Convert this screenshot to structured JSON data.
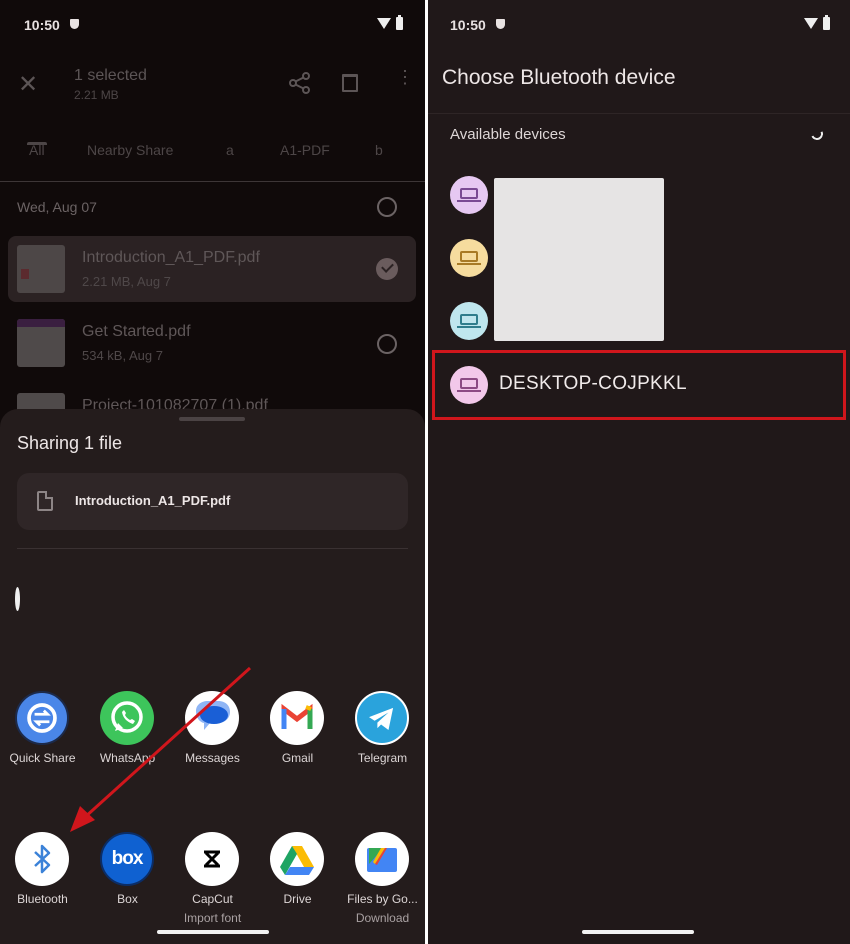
{
  "status_bar": {
    "time": "10:50"
  },
  "left": {
    "appbar": {
      "title": "1 selected",
      "subtitle": "2.21 MB"
    },
    "tabs": [
      "All",
      "Nearby Share",
      "a",
      "A1-PDF",
      "b"
    ],
    "active_tab": "All",
    "date_header": "Wed, Aug 07",
    "files": [
      {
        "name": "Introduction_A1_PDF.pdf",
        "meta": "2.21 MB, Aug 7",
        "selected": true
      },
      {
        "name": "Get Started.pdf",
        "meta": "534 kB, Aug 7",
        "selected": false
      },
      {
        "name": "Project-101082707 (1).pdf",
        "meta": "",
        "selected": false
      }
    ],
    "share_sheet": {
      "title": "Sharing 1 file",
      "file_name": "Introduction_A1_PDF.pdf",
      "apps_row1": [
        {
          "label": "Quick Share",
          "icon": "quick-share-icon",
          "color": "#4a86e8"
        },
        {
          "label": "WhatsApp",
          "icon": "whatsapp-icon",
          "color": "#3dc55b"
        },
        {
          "label": "Messages",
          "icon": "messages-icon",
          "color": "#1a5fd6"
        },
        {
          "label": "Gmail",
          "icon": "gmail-icon",
          "color": "#ea4335"
        },
        {
          "label": "Telegram",
          "icon": "telegram-icon",
          "color": "#2aa3dc"
        }
      ],
      "apps_row2": [
        {
          "label": "Bluetooth",
          "sublabel": "",
          "icon": "bluetooth-icon",
          "color": "#3b82d8"
        },
        {
          "label": "Box",
          "sublabel": "",
          "icon": "box-icon",
          "color": "#0f61d1"
        },
        {
          "label": "CapCut",
          "sublabel": "Import font",
          "icon": "capcut-icon",
          "color": "#000000"
        },
        {
          "label": "Drive",
          "sublabel": "",
          "icon": "drive-icon",
          "color": "#1fa463"
        },
        {
          "label": "Files by Go...",
          "sublabel": "Download",
          "icon": "files-icon",
          "color": "#4285f4"
        }
      ]
    }
  },
  "right": {
    "title": "Choose Bluetooth device",
    "section": "Available devices",
    "devices": [
      {
        "name": "",
        "avatar_bg": "#e6c8f2",
        "icon_color": "#7a4a94"
      },
      {
        "name": "",
        "avatar_bg": "#f6dc9e",
        "icon_color": "#a87a25"
      },
      {
        "name": "",
        "avatar_bg": "#bfe6ee",
        "icon_color": "#2f7d8c"
      },
      {
        "name": "DESKTOP-COJPKKL",
        "avatar_bg": "#f2c8ea",
        "icon_color": "#8c4a84"
      }
    ]
  },
  "annotation": {
    "highlight_color": "#d0161c",
    "arrow_color": "#d0161c"
  }
}
